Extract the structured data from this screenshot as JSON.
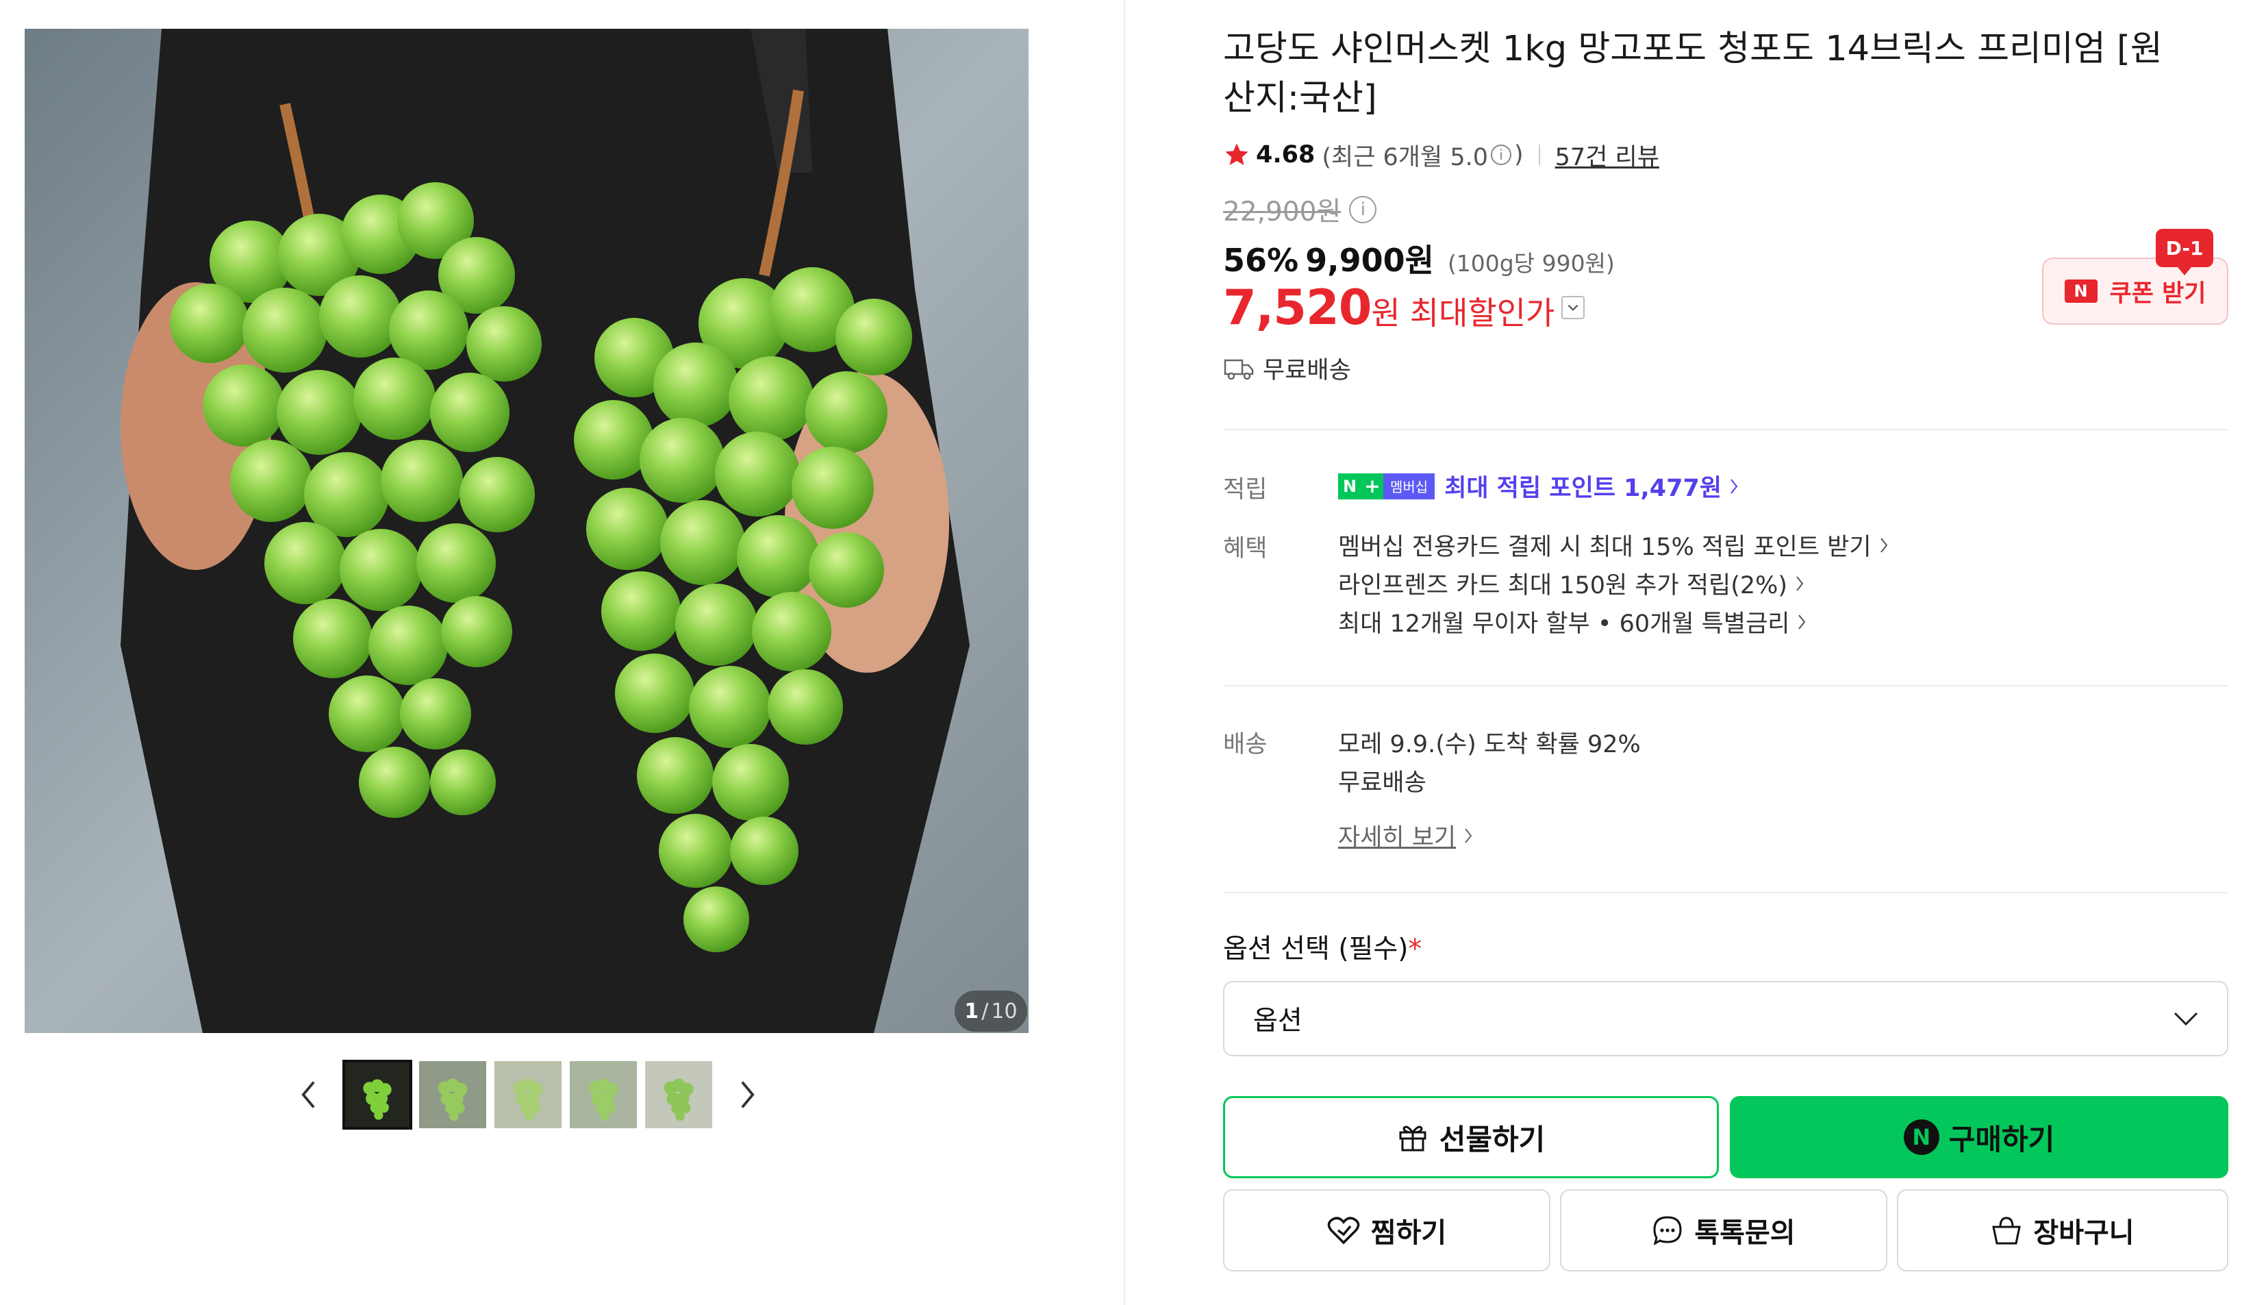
{
  "gallery": {
    "counter_current": "1",
    "counter_total": "10",
    "thumbnail_count": 5,
    "active_thumbnail": 0
  },
  "product": {
    "title": "고당도 샤인머스켓 1kg 망고포도 청포도 14브릭스 프리미엄 [원산지:국산]",
    "rating": "4.68",
    "recent_rating": "(최근 6개월 5.0",
    "recent_rating_close": ")",
    "info_symbol": "i",
    "review_count": "57건 리뷰",
    "original_price": "22,900원",
    "discount_pct": "56%",
    "sale_price": "9,900원",
    "unit_price": "(100g당 990원)",
    "max_price": "7,520",
    "max_price_won": "원",
    "max_price_label": "최대할인가",
    "free_shipping": "무료배송"
  },
  "coupon": {
    "badge": "D-1",
    "n_icon": "N",
    "label": "쿠폰 받기"
  },
  "benefits": {
    "points_label": "적립",
    "membership_n": "N",
    "membership_plus": "+",
    "membership_badge": "멤버십",
    "points_text": "최대 적립 포인트 1,477원",
    "benefit_label": "혜택",
    "items": [
      "멤버십 전용카드 결제 시 최대 15% 적립 포인트 받기",
      "라인프렌즈 카드 최대 150원 추가 적립(2%)",
      "최대 12개월 무이자 할부 • 60개월 특별금리"
    ]
  },
  "shipping": {
    "label": "배송",
    "arrival": "모레 9.9.(수) 도착 확률 92%",
    "fee": "무료배송",
    "detail_link": "자세히 보기"
  },
  "options": {
    "label": "옵션 선택 (필수)",
    "required_mark": "*",
    "placeholder": "옵션"
  },
  "actions": {
    "gift": "선물하기",
    "buy": "구매하기",
    "buy_icon": "N",
    "wish": "찜하기",
    "talk": "톡톡문의",
    "cart": "장바구니"
  },
  "colors": {
    "naver_green": "#03c75a",
    "sale_red": "#e8262d",
    "membership_purple": "#5340ec"
  },
  "icons": [
    "chevron-left-icon",
    "chevron-right-icon",
    "star-icon",
    "info-icon",
    "truck-icon",
    "chevron-down-icon",
    "gift-icon",
    "heart-icon",
    "chat-icon",
    "basket-icon"
  ]
}
